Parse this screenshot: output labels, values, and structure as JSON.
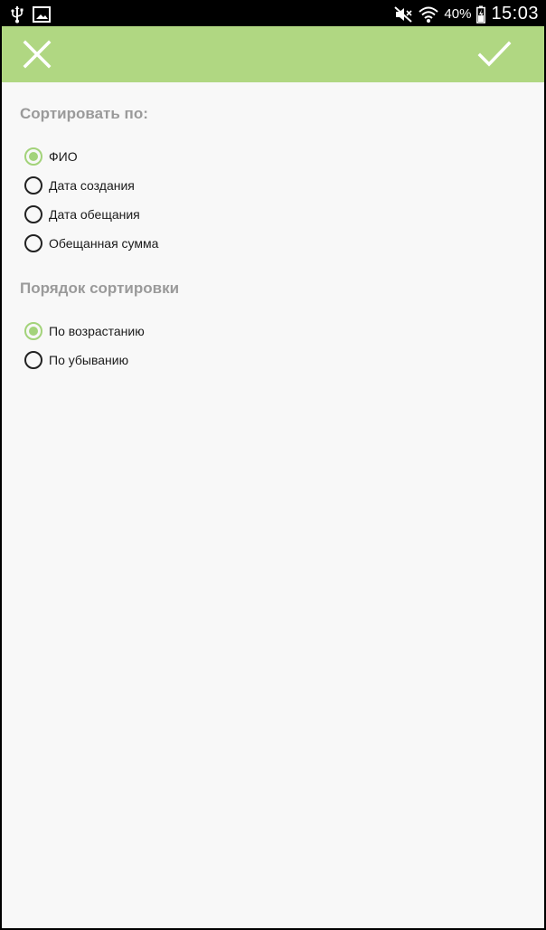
{
  "status_bar": {
    "battery_percent": "40%",
    "time": "15:03",
    "icons": [
      "usb-icon",
      "image-icon",
      "mute-icon",
      "wifi-icon",
      "battery-icon"
    ]
  },
  "toolbar": {
    "background": "#b0d782",
    "close_icon": "close-icon",
    "confirm_icon": "check-icon"
  },
  "sort_by": {
    "title": "Сортировать по:",
    "options": [
      "ФИО",
      "Дата создания",
      "Дата обещания",
      "Обещанная сумма"
    ],
    "selected": "ФИО"
  },
  "sort_order": {
    "title": "Порядок сортировки",
    "options": [
      "По возрастанию",
      "По убыванию"
    ],
    "selected": "По возрастанию"
  },
  "accent_color": "#a3d37a"
}
